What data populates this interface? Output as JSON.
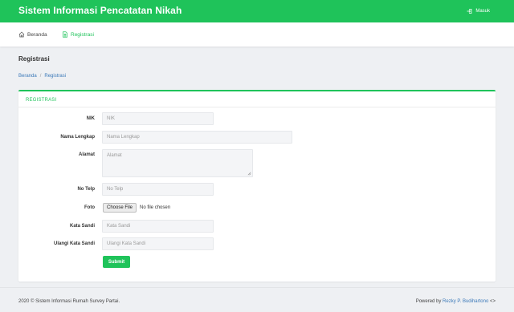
{
  "header": {
    "title": "Sistem Informasi Pencatatan Nikah",
    "login_label": "Masuk"
  },
  "nav": {
    "items": [
      {
        "label": "Beranda"
      },
      {
        "label": "Registrasi"
      }
    ]
  },
  "page": {
    "title": "Registrasi"
  },
  "breadcrumb": {
    "home": "Beranda",
    "separator": "/",
    "current": "Registrasi"
  },
  "form": {
    "title": "REGISTRASI",
    "fields": {
      "nik": {
        "label": "NIK",
        "placeholder": "NIK"
      },
      "nama": {
        "label": "Nama Lengkap",
        "placeholder": "Nama Lengkap"
      },
      "alamat": {
        "label": "Alamat",
        "placeholder": "Alamat"
      },
      "telp": {
        "label": "No Telp",
        "placeholder": "No Telp"
      },
      "foto": {
        "label": "Foto",
        "button": "Choose File",
        "status": "No file chosen"
      },
      "sandi": {
        "label": "Kata Sandi",
        "placeholder": "Kata Sandi"
      },
      "ulangi": {
        "label": "Ulangi Kata Sandi",
        "placeholder": "Ulangi Kata Sandi"
      }
    },
    "submit_label": "Submit"
  },
  "footer": {
    "left": "2020 © Sistem Informasi Rumah Survey Partai.",
    "right_prefix": "Powered by",
    "author": "Rezky P. Budihartono",
    "right_suffix": "<>"
  },
  "colors": {
    "accent": "#1fc35a",
    "link": "#3a78b8"
  }
}
